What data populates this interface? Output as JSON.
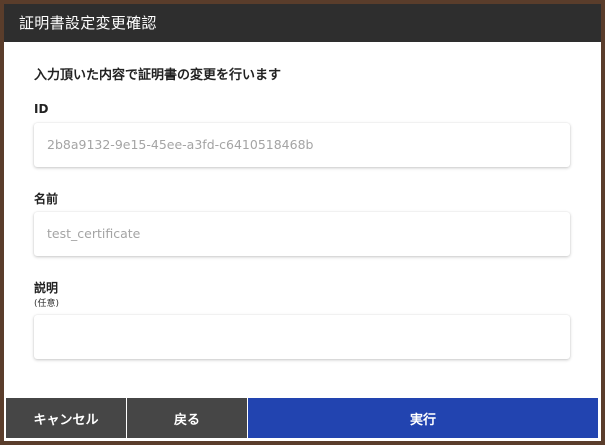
{
  "dialog": {
    "title": "証明書設定変更確認",
    "intro": "入力頂いた内容で証明書の変更を行います"
  },
  "fields": {
    "id": {
      "label": "ID",
      "value": "2b8a9132-9e15-45ee-a3fd-c6410518468b"
    },
    "name": {
      "label": "名前",
      "value": "test_certificate"
    },
    "description": {
      "label": "説明",
      "sublabel": "(任意)",
      "value": ""
    }
  },
  "footer": {
    "cancel_label": "キャンセル",
    "back_label": "戻る",
    "execute_label": "実行"
  },
  "colors": {
    "titlebar": "#2e2e2e",
    "secondary_button": "#464646",
    "primary_button": "#2244b0",
    "backdrop": "#5a3d2b"
  }
}
